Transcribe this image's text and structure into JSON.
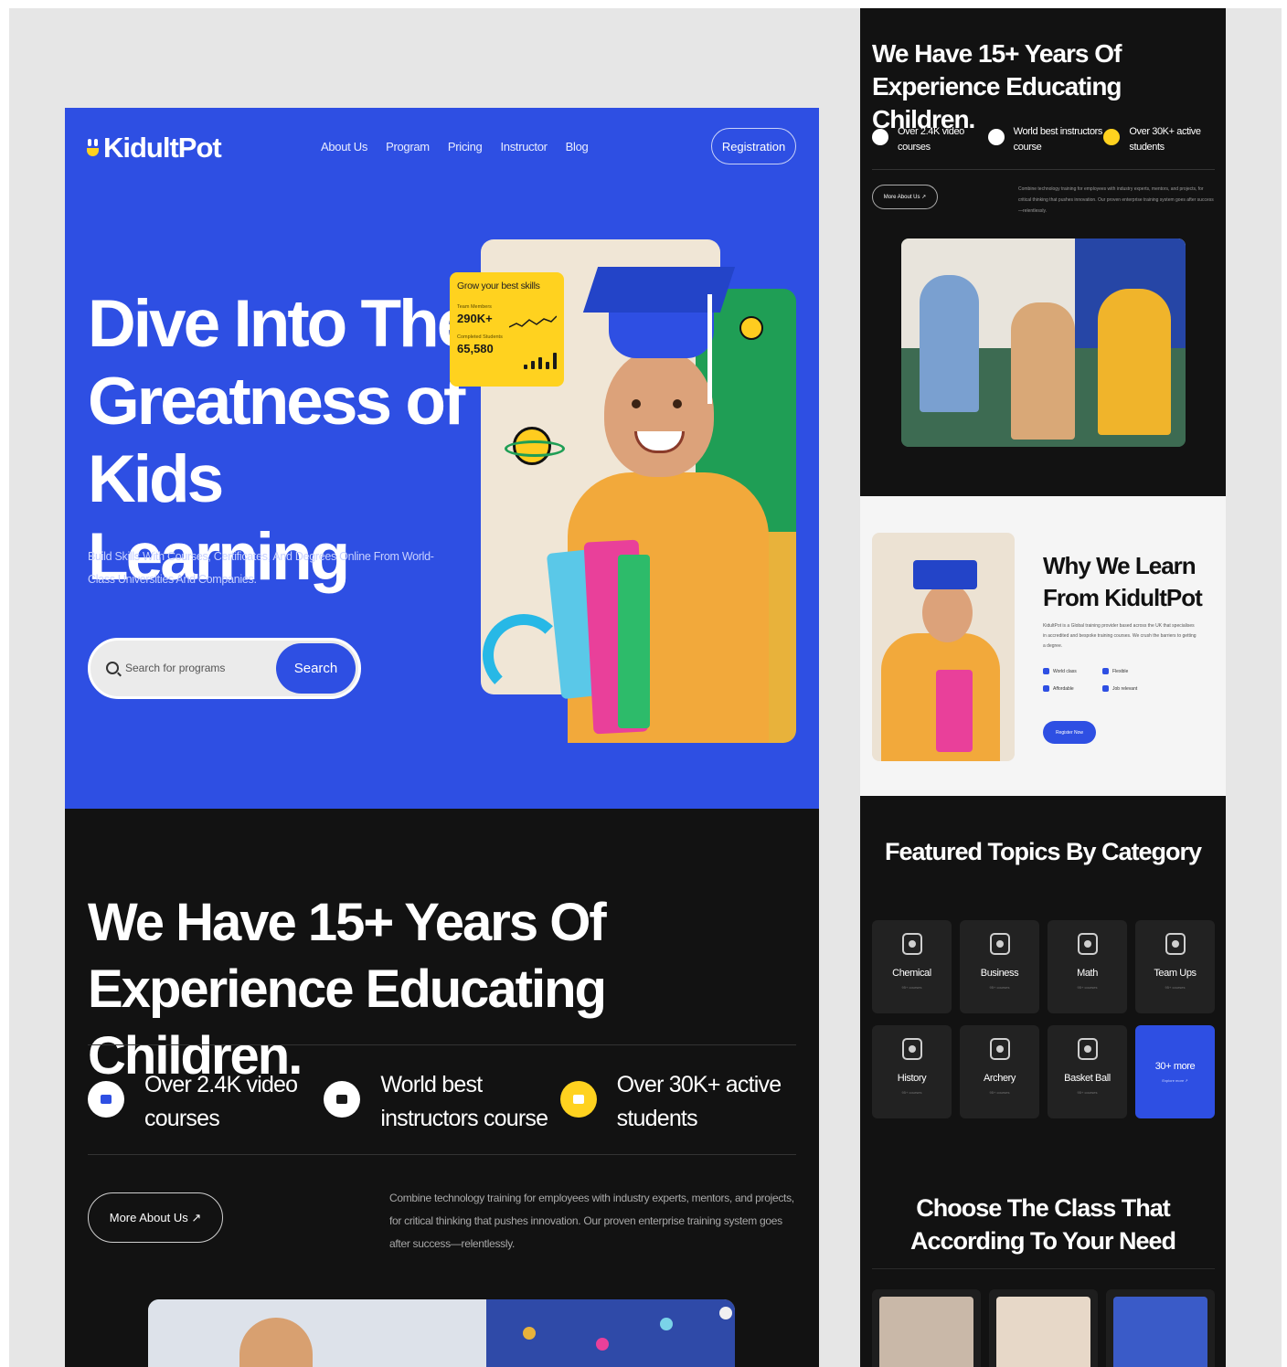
{
  "brand": {
    "name": "KidultPot",
    "accent": "#2e4fe3",
    "yellow": "#ffd21f",
    "dark": "#121212"
  },
  "nav": {
    "items": [
      "About Us",
      "Program",
      "Pricing",
      "Instructor",
      "Blog"
    ],
    "registration": "Registration"
  },
  "hero": {
    "title": "Dive Into The Greatness of Kids Learning",
    "subtitle": "Build Skills With Courses, Certificates, And Degrees Online From World-Class Universities And Companies.",
    "search_placeholder": "Search for programs",
    "search_button": "Search",
    "stats_card": {
      "title": "Grow your best skills",
      "label1": "Team Members",
      "value1": "290K+",
      "label2": "Completed Students",
      "value2": "65,580"
    }
  },
  "experience": {
    "title": "We Have 15+ Years Of Experience Educating Children.",
    "features": [
      {
        "icon": "video-icon",
        "text": "Over 2.4K video courses"
      },
      {
        "icon": "certificate-icon",
        "text": "World best instructors course"
      },
      {
        "icon": "students-icon",
        "text": "Over 30K+ active students"
      }
    ],
    "more_button": "More About Us ↗",
    "description": "Combine technology training for employees with industry experts, mentors, and projects, for critical thinking that pushes innovation. Our proven enterprise training system goes after success—relentlessly."
  },
  "side": {
    "experience": {
      "title": "We Have 15+ Years Of Experience Educating Children.",
      "features": [
        "Over 2.4K video courses",
        "World best instructors course",
        "Over 30K+ active students"
      ],
      "more_button": "More About Us ↗",
      "description": "Combine technology training for employees with industry experts, mentors, and projects, for critical thinking that pushes innovation. Our proven enterprise training system goes after success—relentlessly."
    },
    "why": {
      "title": "Why We Learn From KidultPot",
      "description": "KidultPot is a Global training provider based across the UK that specialises in accredited and bespoke training courses. We crush the barriers to getting a degree.",
      "checks": [
        "World class",
        "Flexible",
        "Affordable",
        "Job relevant"
      ],
      "button": "Register Now"
    },
    "topics": {
      "title": "Featured Topics By Category",
      "categories": [
        {
          "name": "Chemical",
          "count": "95+ courses",
          "icon": "atom-icon"
        },
        {
          "name": "Business",
          "count": "95+ courses",
          "icon": "chart-icon"
        },
        {
          "name": "Math",
          "count": "95+ courses",
          "icon": "calculator-icon"
        },
        {
          "name": "Team Ups",
          "count": "95+ courses",
          "icon": "team-icon"
        },
        {
          "name": "History",
          "count": "95+ courses",
          "icon": "trophy-icon"
        },
        {
          "name": "Archery",
          "count": "95+ courses",
          "icon": "target-icon"
        },
        {
          "name": "Basket Ball",
          "count": "95+ courses",
          "icon": "ball-icon"
        }
      ],
      "more": {
        "label": "30+ more",
        "link": "Explore more ↗"
      }
    },
    "classes": {
      "title": "Choose The Class That According To Your Need"
    }
  }
}
